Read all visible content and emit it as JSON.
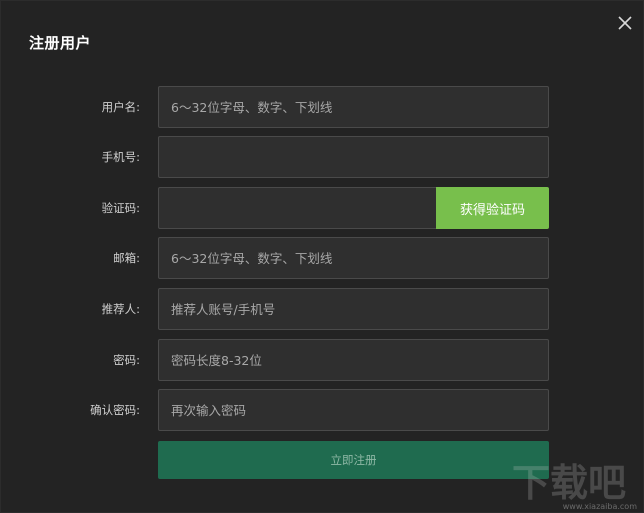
{
  "dialog": {
    "title": "注册用户",
    "close_icon": "close-icon"
  },
  "form": {
    "username": {
      "label": "用户名:",
      "placeholder": "6～32位字母、数字、下划线",
      "value": ""
    },
    "phone": {
      "label": "手机号:",
      "placeholder": "",
      "value": ""
    },
    "code": {
      "label": "验证码:",
      "placeholder": "",
      "value": "",
      "button_label": "获得验证码"
    },
    "email": {
      "label": "邮箱:",
      "placeholder": "6～32位字母、数字、下划线",
      "value": ""
    },
    "referrer": {
      "label": "推荐人:",
      "placeholder": "推荐人账号/手机号",
      "value": ""
    },
    "password": {
      "label": "密码:",
      "placeholder": "密码长度8-32位",
      "value": ""
    },
    "confirm_password": {
      "label": "确认密码:",
      "placeholder": "再次输入密码",
      "value": ""
    },
    "submit_label": "立即注册"
  },
  "watermark": {
    "text": "下载吧",
    "url": "www.xiazaiba.com"
  },
  "colors": {
    "background": "#232323",
    "input_bg": "#2f2f2f",
    "input_border": "#4a4a4a",
    "code_button": "#78bf4c",
    "submit_button": "#1f6b4f"
  }
}
